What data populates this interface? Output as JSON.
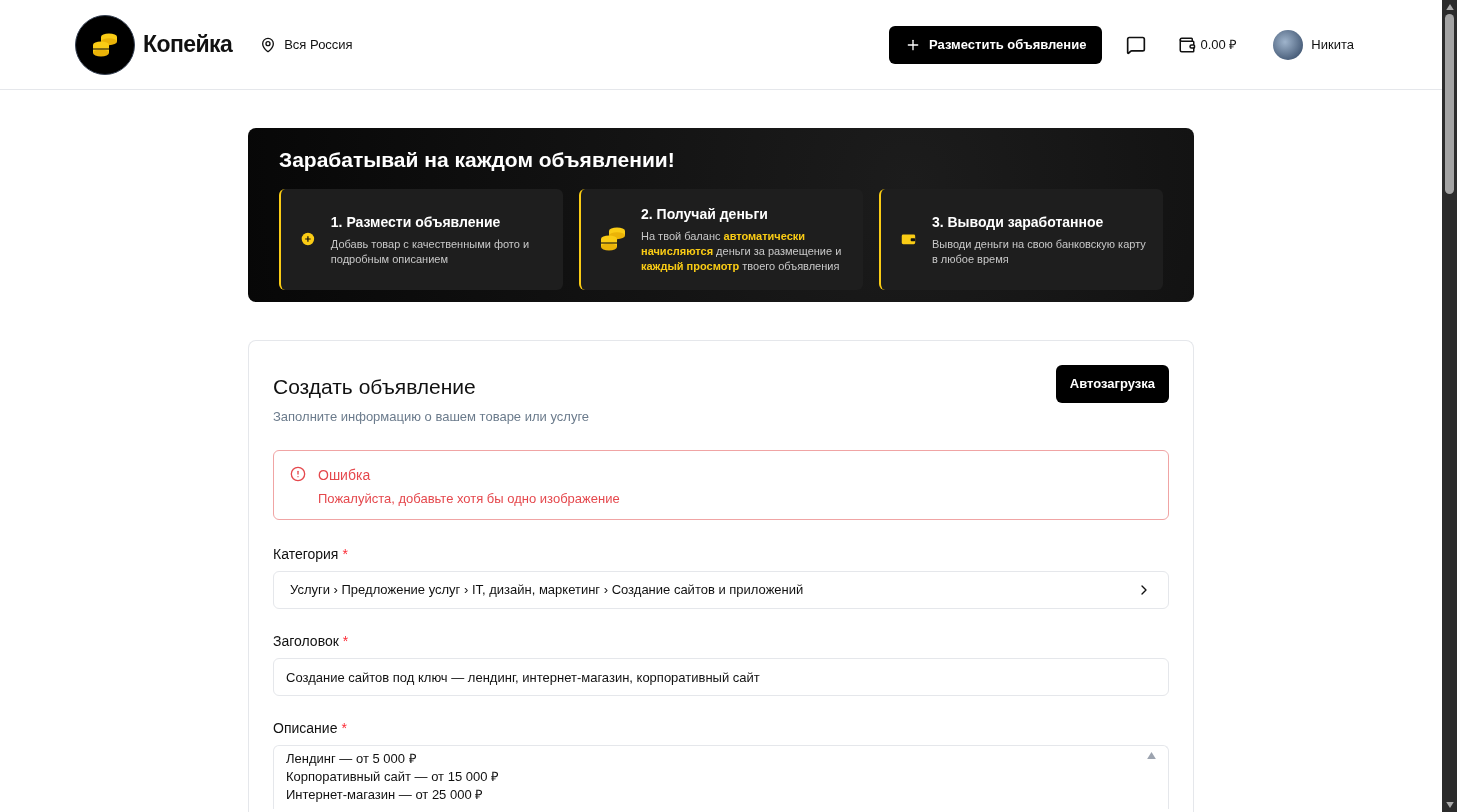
{
  "header": {
    "brand": "Копейка",
    "location": "Вся Россия",
    "post_button": "Разместить объявление",
    "balance": "0.00 ₽",
    "user": "Никита"
  },
  "banner": {
    "title": "Зарабатывай на каждом объявлении!",
    "steps": [
      {
        "kind": "plus",
        "title": "1. Размести объявление",
        "text": "Добавь товар с качественными фото и подробным описанием"
      },
      {
        "kind": "coins",
        "title": "2. Получай деньги",
        "text": "На твой баланс **автоматически начисляются** деньги за размещение и **каждый просмотр** твоего объявления"
      },
      {
        "kind": "wallet",
        "title": "3. Выводи заработанное",
        "text": "Выводи деньги на свою банковскую карту в любое время"
      }
    ]
  },
  "form": {
    "title": "Создать объявление",
    "subtitle": "Заполните информацию о вашем товаре или услуге",
    "autoload_button": "Автозагрузка",
    "error": {
      "title": "Ошибка",
      "message": "Пожалуйста, добавьте хотя бы одно изображение"
    },
    "category": {
      "label": "Категория",
      "required_mark": "*",
      "value": "Услуги › Предложение услуг › IT, дизайн, маркетинг › Создание сайтов и приложений"
    },
    "heading": {
      "label": "Заголовок",
      "required_mark": "*",
      "value": "Создание сайтов под ключ — лендинг, интернет-магазин, корпоративный сайт"
    },
    "description": {
      "label": "Описание",
      "required_mark": "*",
      "lines": [
        "Лендинг — от 5 000 ₽",
        "Корпоративный сайт — от 15 000 ₽",
        "Интернет-магазин — от 25 000 ₽"
      ]
    }
  }
}
